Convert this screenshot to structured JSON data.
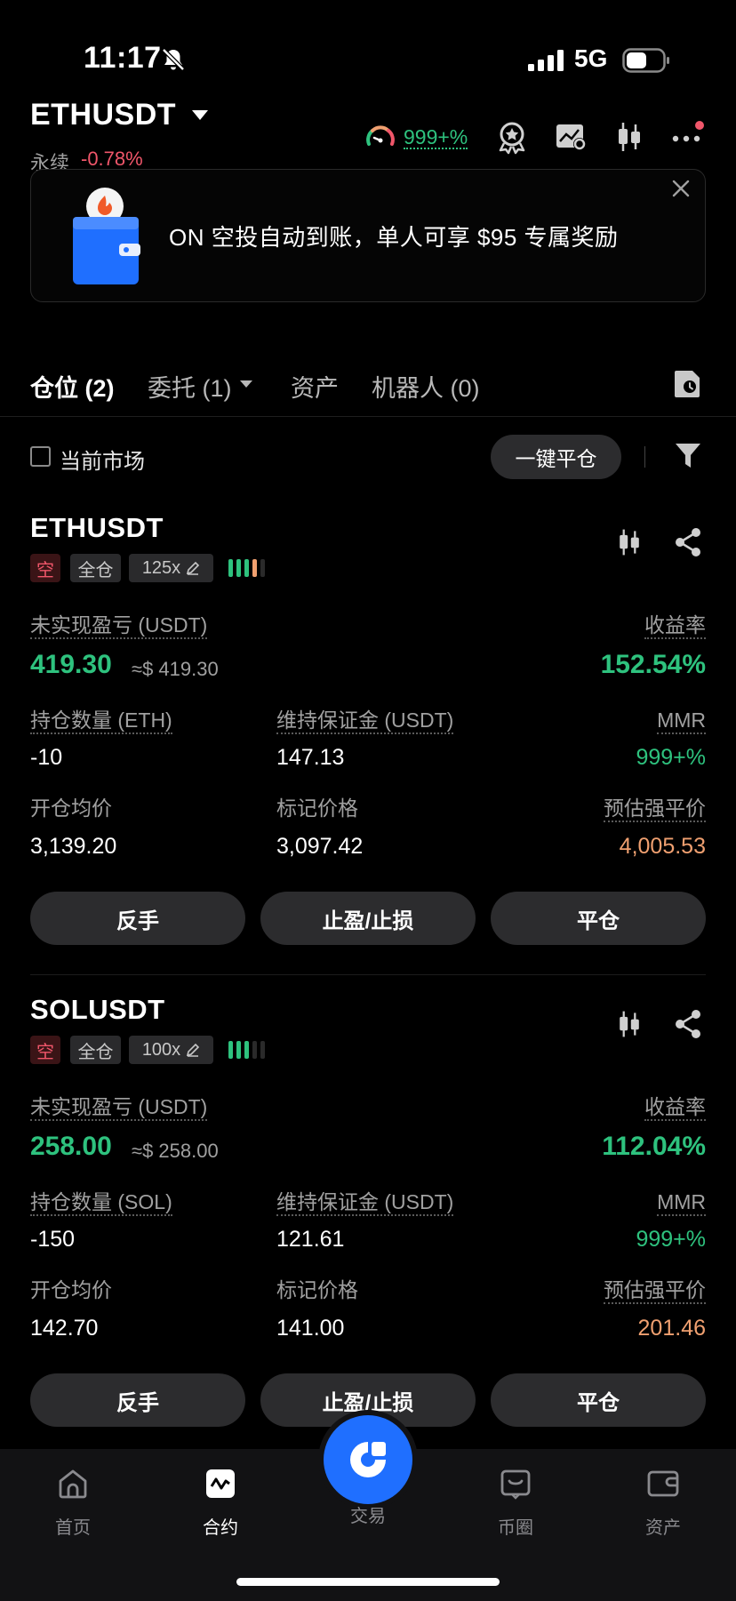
{
  "status_bar": {
    "time": "11:17",
    "network": "5G"
  },
  "header": {
    "symbol": "ETHUSDT",
    "contract_type": "永续",
    "change_pct": "-0.78%",
    "gauge_value": "999+%"
  },
  "banner": {
    "text": "ON 空投自动到账，单人可享 $95 专属奖励"
  },
  "tabs": [
    {
      "label": "仓位 (2)",
      "active": true
    },
    {
      "label": "委托 (1)",
      "active": false
    },
    {
      "label": "资产",
      "active": false
    },
    {
      "label": "机器人 (0)",
      "active": false
    }
  ],
  "filter": {
    "current_market_label": "当前市场",
    "close_all_label": "一键平仓"
  },
  "positions": [
    {
      "symbol": "ETHUSDT",
      "side": "空",
      "margin_mode": "全仓",
      "leverage": "125x",
      "risk_bars": {
        "filled": 4,
        "total": 5
      },
      "unrealized_pnl_label": "未实现盈亏 (USDT)",
      "unrealized_pnl": "419.30",
      "unrealized_pnl_approx": "≈$ 419.30",
      "roe_label": "收益率",
      "roe": "152.54%",
      "qty_label": "持仓数量 (ETH)",
      "qty": "-10",
      "maint_margin_label": "维持保证金 (USDT)",
      "maint_margin": "147.13",
      "mmr_label": "MMR",
      "mmr": "999+%",
      "entry_label": "开仓均价",
      "entry_price": "3,139.20",
      "mark_label": "标记价格",
      "mark_price": "3,097.42",
      "liq_label": "预估强平价",
      "liq_price": "4,005.53",
      "btn_reverse": "反手",
      "btn_tpsl": "止盈/止损",
      "btn_close": "平仓"
    },
    {
      "symbol": "SOLUSDT",
      "side": "空",
      "margin_mode": "全仓",
      "leverage": "100x",
      "risk_bars": {
        "filled": 3,
        "total": 5
      },
      "unrealized_pnl_label": "未实现盈亏 (USDT)",
      "unrealized_pnl": "258.00",
      "unrealized_pnl_approx": "≈$ 258.00",
      "roe_label": "收益率",
      "roe": "112.04%",
      "qty_label": "持仓数量 (SOL)",
      "qty": "-150",
      "maint_margin_label": "维持保证金 (USDT)",
      "maint_margin": "121.61",
      "mmr_label": "MMR",
      "mmr": "999+%",
      "entry_label": "开仓均价",
      "entry_price": "142.70",
      "mark_label": "标记价格",
      "mark_price": "141.00",
      "liq_label": "预估强平价",
      "liq_price": "201.46",
      "btn_reverse": "反手",
      "btn_tpsl": "止盈/止损",
      "btn_close": "平仓"
    }
  ],
  "bottom_nav": [
    {
      "label": "首页",
      "icon": "home-icon",
      "active": false
    },
    {
      "label": "合约",
      "icon": "futures-icon",
      "active": true
    },
    {
      "label": "交易",
      "icon": "trade-icon",
      "active": false
    },
    {
      "label": "币圈",
      "icon": "community-icon",
      "active": false
    },
    {
      "label": "资产",
      "icon": "wallet-icon",
      "active": false
    }
  ],
  "colors": {
    "green": "#2ec27e",
    "red": "#f0566a",
    "orange": "#f0a070",
    "accent": "#1f6fff"
  }
}
